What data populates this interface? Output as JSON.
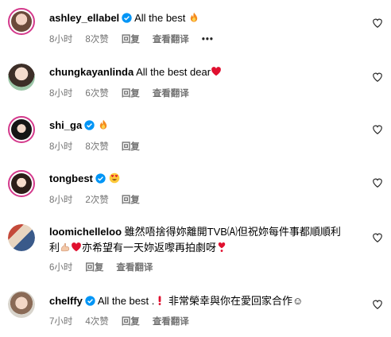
{
  "comments": [
    {
      "username": "ashley_ellabel",
      "verified": true,
      "text": "All the best",
      "emoji": "fire-emoji",
      "time": "8小时",
      "likes": "8次赞",
      "reply": "回复",
      "translate": "查看翻译",
      "more": "•••",
      "story_ring": true
    },
    {
      "username": "chungkayanlinda",
      "verified": false,
      "text": "All the best dear",
      "emoji": "red-heart-emoji",
      "time": "8小时",
      "likes": "6次赞",
      "reply": "回复",
      "translate": "查看翻译"
    },
    {
      "username": "shi_ga",
      "verified": true,
      "emoji": "fire-emoji",
      "time": "8小时",
      "likes": "8次赞",
      "reply": "回复",
      "story_ring": true
    },
    {
      "username": "tongbest",
      "verified": true,
      "emoji": "heart-eyes-emoji",
      "time": "8小时",
      "likes": "2次赞",
      "reply": "回复",
      "story_ring": true
    },
    {
      "username": "loomichelleloo",
      "verified": false,
      "text_line1": "雖然唔捨得妳離開TVB🄐但祝妳每件事都順順利",
      "text_line2a": "利",
      "text_line2b": "亦希望有一天妳返嚟再拍劇呀",
      "time": "6小时",
      "reply": "回复",
      "translate": "查看翻译"
    },
    {
      "username": "chelffy",
      "verified": true,
      "text": "All the best .",
      "text2": "非常榮幸與你在愛回家合作☺",
      "time": "7小时",
      "likes": "4次赞",
      "reply": "回复",
      "translate": "查看翻译"
    }
  ],
  "colors": {
    "verified": "#0095f6",
    "meta": "#737373",
    "heart": "#e0102f",
    "story_ring": "#d43a8c"
  }
}
